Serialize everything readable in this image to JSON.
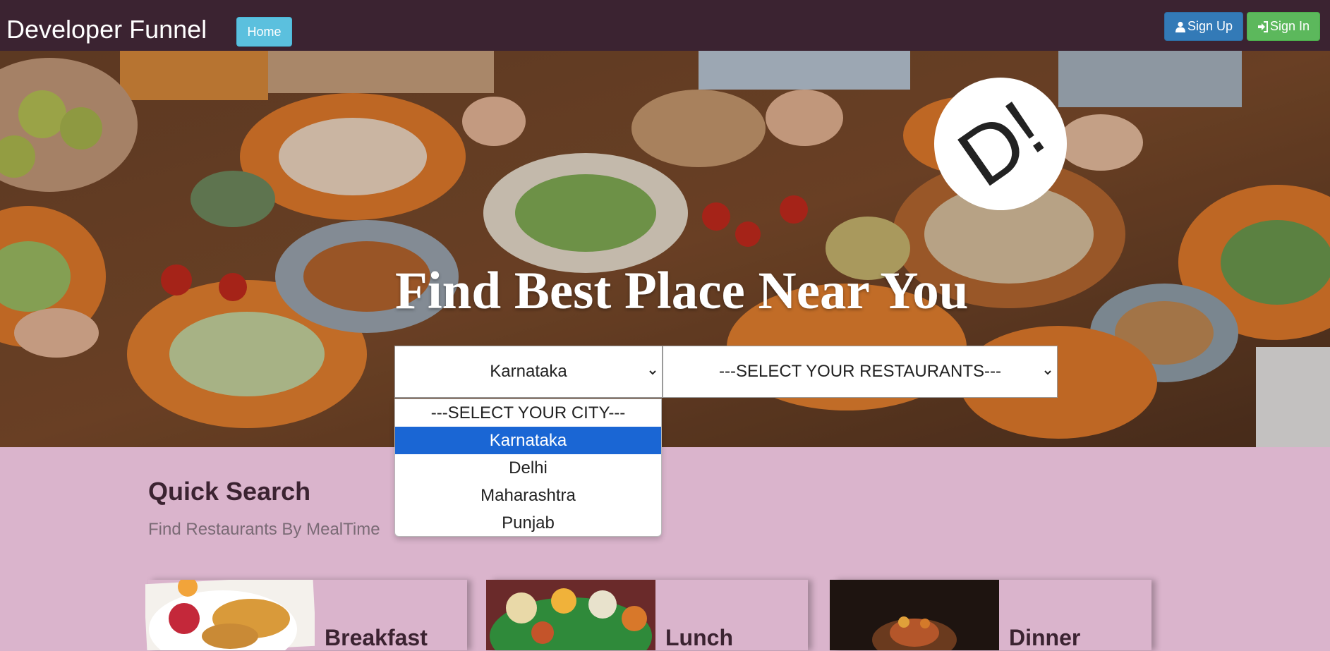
{
  "navbar": {
    "brand": "Developer Funnel",
    "home_label": "Home",
    "signup_label": "Sign Up",
    "signin_label": "Sign In",
    "signup_icon": "user-icon",
    "signin_icon": "log-in-icon"
  },
  "hero": {
    "logo_text": "D!",
    "title": "Find Best Place Near You",
    "city_select": {
      "value": "Karnataka",
      "options": [
        "---SELECT YOUR CITY---",
        "Karnataka",
        "Delhi",
        "Maharashtra",
        "Punjab"
      ],
      "highlighted": "Karnataka"
    },
    "restaurant_select": {
      "value": "---SELECT YOUR RESTAURANTS---"
    }
  },
  "quick_search": {
    "title": "Quick Search",
    "subtitle": "Find Restaurants By MealTime",
    "cards": [
      {
        "label": "Breakfast"
      },
      {
        "label": "Lunch"
      },
      {
        "label": "Dinner"
      }
    ]
  },
  "colors": {
    "navbar_bg": "#3b2331",
    "page_bg": "#dab4cc",
    "home_btn": "#5bc0de",
    "signup_btn": "#337ab7",
    "signin_btn": "#5cb85c",
    "dropdown_highlight": "#1a66d4"
  }
}
